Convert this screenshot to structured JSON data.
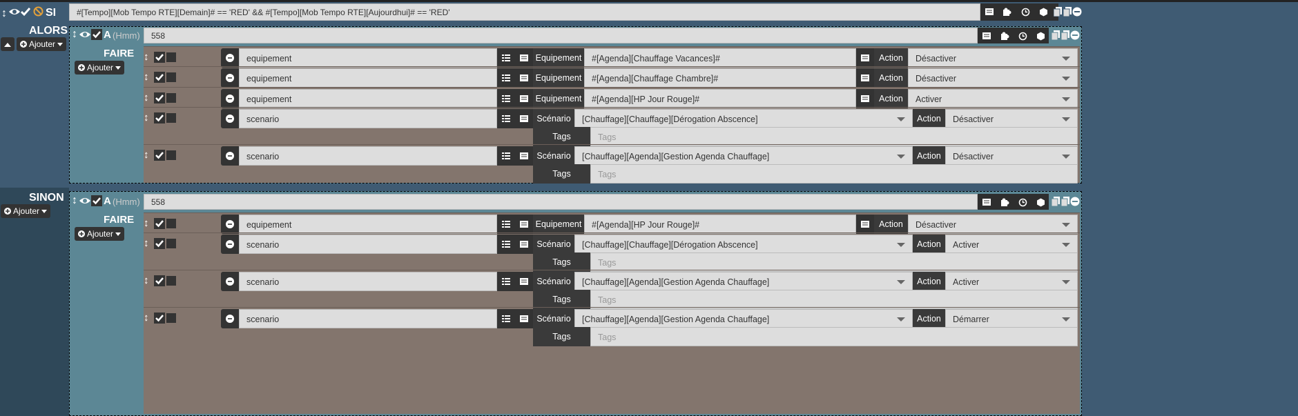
{
  "si": {
    "label": "SI",
    "condition": "#[Tempo][Mob Tempo RTE][Demain]# == 'RED'  && #[Tempo][Mob Tempo RTE][Aujourdhui]# == 'RED'"
  },
  "alors": {
    "label": "ALORS",
    "ajouter": "Ajouter"
  },
  "sinon": {
    "label": "SINON",
    "ajouter": "Ajouter"
  },
  "block1": {
    "a_label": "A",
    "hmm": "(Hmm)",
    "value": "558",
    "faire": "FAIRE",
    "ajouter": "Ajouter"
  },
  "block2": {
    "a_label": "A",
    "hmm": "(Hmm)",
    "value": "558",
    "faire": "FAIRE",
    "ajouter": "Ajouter"
  },
  "labels": {
    "equipement": "Equipement",
    "scenario": "Scénario",
    "action": "Action",
    "tags": "Tags",
    "tags_placeholder": "Tags"
  },
  "rows1": [
    {
      "type": "equipement",
      "target": "#[Agenda][Chauffage Vacances]#",
      "action": "Désactiver"
    },
    {
      "type": "equipement",
      "target": "#[Agenda][Chauffage Chambre]#",
      "action": "Désactiver"
    },
    {
      "type": "equipement",
      "target": "#[Agenda][HP Jour Rouge]#",
      "action": "Activer"
    },
    {
      "type": "scenario",
      "target": "[Chauffage][Chauffage][Dérogation Abscence]",
      "action": "Désactiver"
    },
    {
      "type": "scenario",
      "target": "[Chauffage][Agenda][Gestion Agenda Chauffage]",
      "action": "Désactiver"
    }
  ],
  "rows2": [
    {
      "type": "equipement",
      "target": "#[Agenda][HP Jour Rouge]#",
      "action": "Désactiver"
    },
    {
      "type": "scenario",
      "target": "[Chauffage][Chauffage][Dérogation Abscence]",
      "action": "Activer"
    },
    {
      "type": "scenario",
      "target": "[Chauffage][Agenda][Gestion Agenda Chauffage]",
      "action": "Activer"
    },
    {
      "type": "scenario",
      "target": "[Chauffage][Agenda][Gestion Agenda Chauffage]",
      "action": "Démarrer"
    }
  ]
}
